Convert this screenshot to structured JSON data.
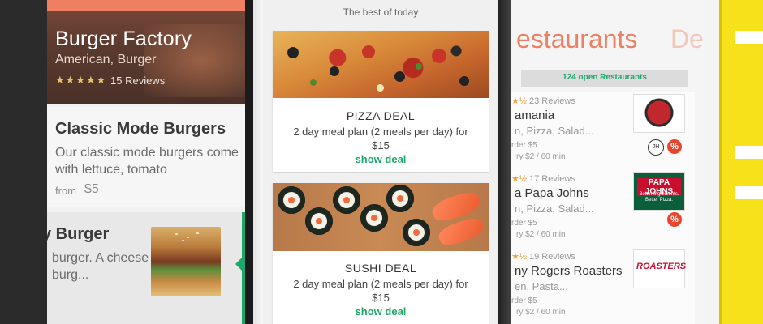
{
  "phone1": {
    "hero": {
      "title": "Burger Factory",
      "subtitle": "American, Burger",
      "stars": "★★★★★",
      "reviews": "15 Reviews"
    },
    "card1": {
      "title": "Classic Mode Burgers",
      "description": "Our classic mode burgers come with lettuce, tomato",
      "from_label": "from",
      "price": "$5"
    },
    "card2": {
      "title": "y Burger",
      "description": "burger. A cheese burg..."
    }
  },
  "phone2": {
    "header": "The best of today",
    "deals": [
      {
        "title": "PIZZA DEAL",
        "description": "2 day meal plan (2 meals per day) for $15",
        "link": "show deal"
      },
      {
        "title": "SUSHI DEAL",
        "description": "2 day meal plan (2 meals per day) for $15",
        "link": "show deal"
      }
    ]
  },
  "phone3": {
    "title": "estaurants",
    "title_next": "De",
    "open_count": "124 open Restaurants",
    "restaurants": [
      {
        "stars": "★½",
        "reviews": "23 Reviews",
        "name": "amania",
        "categories": "n, Pizza, Salad...",
        "min_order": "rder $5",
        "delivery": "ry $2 / 60 min",
        "logo": "pastamania-logo",
        "badge": "%",
        "extra": "JH"
      },
      {
        "stars": "★½",
        "reviews": "17 Reviews",
        "name": "a Papa Johns",
        "categories": "n, Pizza, Salad...",
        "min_order": "rder $5",
        "delivery": "ry $2 / 60 min",
        "logo": "papa-johns-logo",
        "badge": "%",
        "logo_text": "PAPA JOHNS",
        "logo_tagline": "Better Ingredients. Better Pizza."
      },
      {
        "stars": "★½",
        "reviews": "19 Reviews",
        "name": "ny Rogers Roasters",
        "categories": "en, Pasta...",
        "min_order": "rder $5",
        "delivery": "ry $2 / 60 min",
        "logo": "kenny-rogers-logo",
        "logo_text": "ROASTERS"
      }
    ],
    "colors": {
      "accent": "#ef7f62",
      "green": "#1fa66b",
      "device_yellow": "#f6e11a"
    }
  }
}
